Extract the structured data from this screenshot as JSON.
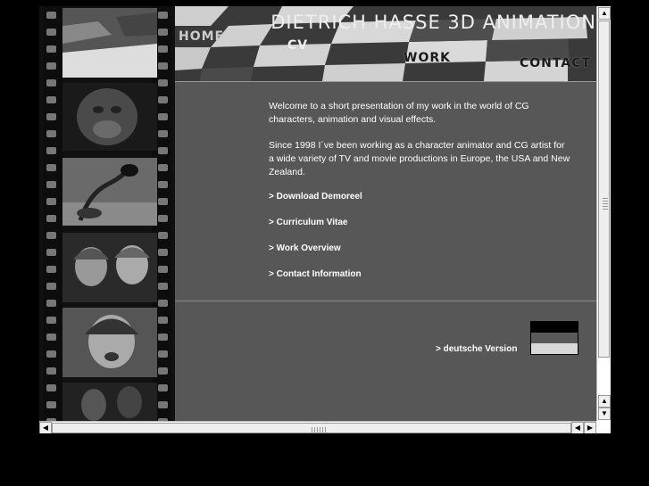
{
  "header": {
    "title": "DIETRICH HASSE    3D ANIMATION",
    "nav": {
      "home": "HOME",
      "cv": "CV",
      "work": "WORK",
      "contact": "CONTACT"
    }
  },
  "content": {
    "intro_1": "Welcome to a short presentation of my work in the world of CG characters, animation and visual effects.",
    "intro_2": "Since 1998 I´ve been working as a character animator and CG artist for a wide variety of TV and movie productions in Europe, the USA and New Zealand.",
    "links": {
      "demoreel": "> Download Demoreel",
      "cv": "> Curriculum Vitae",
      "work": "> Work Overview",
      "contact": "> Contact Information"
    },
    "language_link": "> deutsche Version"
  },
  "flag_colors": [
    "#000000",
    "#5a5a5a",
    "#d8d8d8"
  ],
  "scrollbar_arrows": {
    "up": "▲",
    "down": "▼",
    "left": "◀",
    "right": "▶"
  }
}
